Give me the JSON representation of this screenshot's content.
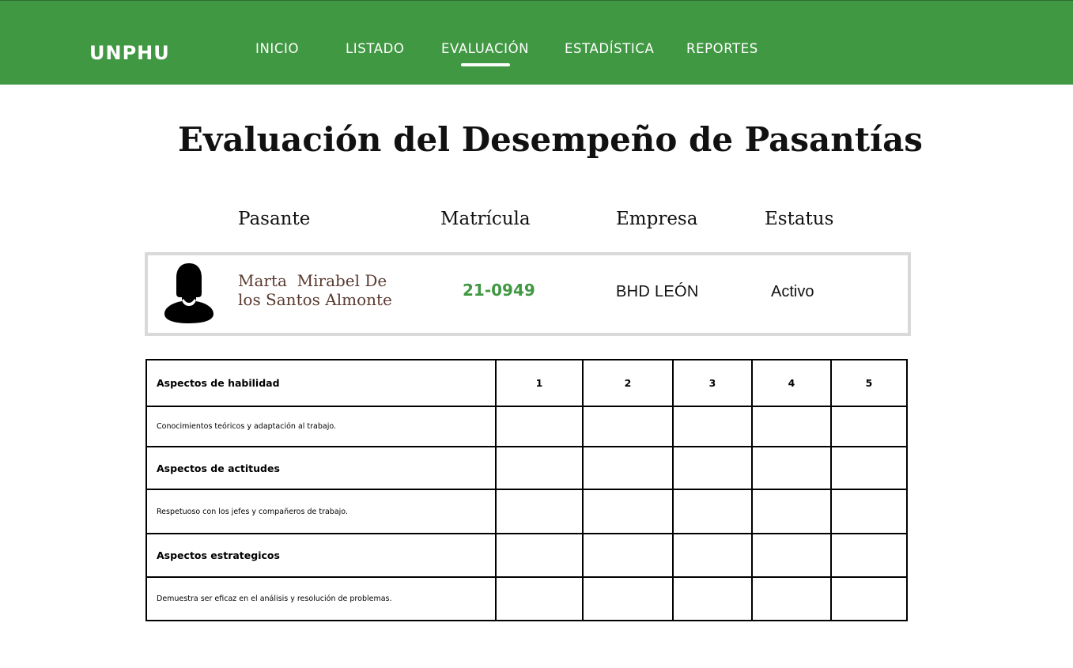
{
  "brand": "UNPHU",
  "nav": {
    "items": [
      {
        "label": "INICIO",
        "active": false
      },
      {
        "label": "LISTADO",
        "active": false
      },
      {
        "label": "EVALUACIÓN",
        "active": true
      },
      {
        "label": "ESTADÍSTICA",
        "active": false
      },
      {
        "label": "REPORTES",
        "active": false
      }
    ]
  },
  "colors": {
    "primary": "#419843",
    "name_text": "#5a3a30",
    "card_border": "#d9d9d9"
  },
  "page_title": "Evaluación del Desempeño de Pasantías",
  "columns": {
    "pasante": "Pasante",
    "matricula": "Matrícula",
    "empresa": "Empresa",
    "estatus": "Estatus"
  },
  "student": {
    "avatar_icon": "person-silhouette-icon",
    "name_line1": "Marta  Mirabel De",
    "name_line2": "los Santos Almonte",
    "id": "21-0949",
    "company": "BHD LEÓN",
    "status": "Activo"
  },
  "evaluation": {
    "scale": [
      "1",
      "2",
      "3",
      "4",
      "5"
    ],
    "rows": [
      {
        "type": "header",
        "label": "Aspectos de habilidad",
        "show_scale": true
      },
      {
        "type": "item",
        "label": "Conocimientos teóricos y adaptación al trabajo."
      },
      {
        "type": "header",
        "label": "Aspectos de actitudes"
      },
      {
        "type": "item",
        "label": "Respetuoso con los jefes y compañeros de trabajo."
      },
      {
        "type": "header",
        "label": "Aspectos estrategicos"
      },
      {
        "type": "item",
        "label": "Demuestra ser eficaz en el análisis y resolución de problemas."
      }
    ]
  }
}
